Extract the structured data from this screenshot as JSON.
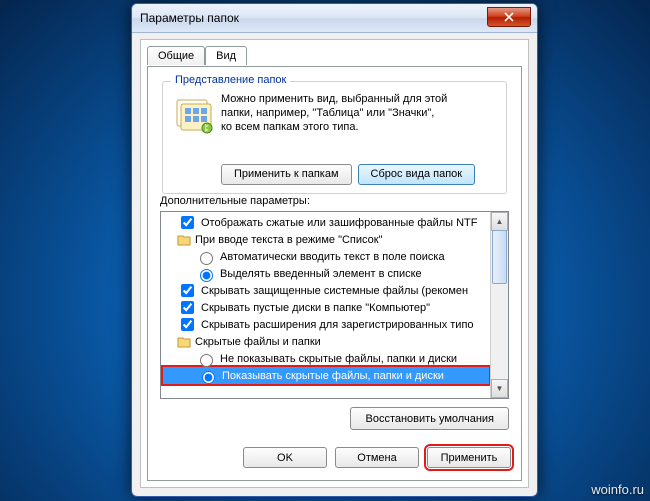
{
  "title": "Параметры папок",
  "tabs": {
    "general": "Общие",
    "view": "Вид"
  },
  "group": {
    "label": "Представление папок",
    "text1": "Можно применить вид, выбранный для этой",
    "text2": "папки, например, \"Таблица\" или \"Значки\",",
    "text3": "ко всем папкам этого типа.",
    "apply_btn": "Применить к папкам",
    "reset_btn": "Сброс вида папок"
  },
  "adv_label": "Дополнительные параметры:",
  "tree": {
    "n0": "Отображать сжатые или зашифрованные файлы NTF",
    "n1": "При вводе текста в режиме \"Список\"",
    "n2": "Автоматически вводить текст в поле поиска",
    "n3": "Выделять введенный элемент в списке",
    "n4": "Скрывать защищенные системные файлы (рекомен",
    "n5": "Скрывать пустые диски в папке \"Компьютер\"",
    "n6": "Скрывать расширения для зарегистрированных типо",
    "n7": "Скрытые файлы и папки",
    "n8": "Не показывать скрытые файлы, папки и диски",
    "n9": "Показывать скрытые файлы, папки и диски"
  },
  "restore_btn": "Восстановить умолчания",
  "buttons": {
    "ok": "OK",
    "cancel": "Отмена",
    "apply": "Применить"
  },
  "watermark": "woinfo.ru"
}
